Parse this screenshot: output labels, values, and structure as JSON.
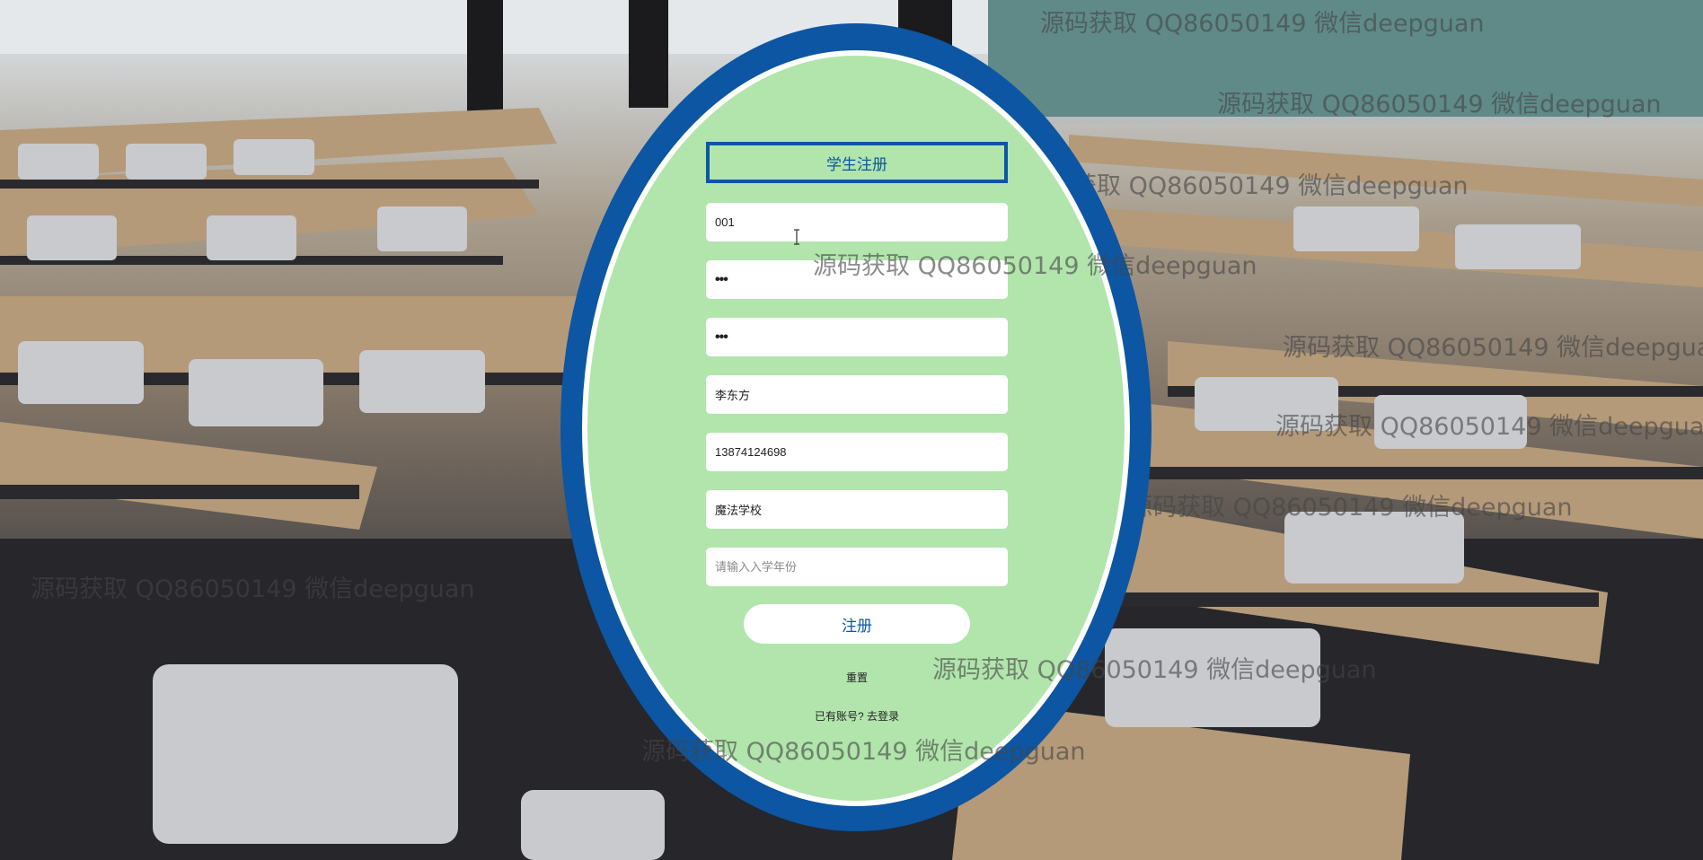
{
  "form": {
    "title": "学生注册",
    "fields": {
      "account": {
        "value": "001"
      },
      "password": {
        "value": "•••"
      },
      "confirm_password": {
        "value": "•••"
      },
      "name": {
        "value": "李东方"
      },
      "phone": {
        "value": "13874124698"
      },
      "school": {
        "value": "魔法学校"
      },
      "enroll_year": {
        "value": "",
        "placeholder": "请输入入学年份"
      }
    },
    "submit_label": "注册",
    "reset_label": "重置",
    "login_prompt": "已有账号?",
    "login_link": "去登录"
  },
  "watermark": "源码获取 QQ86050149 微信deepguan",
  "colors": {
    "accent": "#0c56a3",
    "panel": "#b1e5ac",
    "field_bg": "#ffffff"
  }
}
